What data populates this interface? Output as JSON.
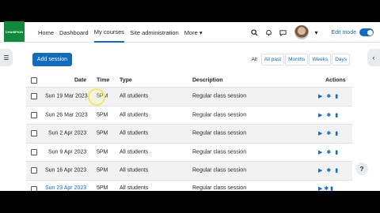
{
  "logo": {
    "text": "CHAMPION"
  },
  "nav": {
    "items": [
      {
        "label": "Home"
      },
      {
        "label": "Dashboard"
      },
      {
        "label": "My courses",
        "active": true
      },
      {
        "label": "Site administration"
      },
      {
        "label": "More ▾"
      }
    ],
    "search_icon": "search-icon",
    "bell_icon": "bell-icon",
    "chat_icon": "chat-icon",
    "edit_mode_label": "Edit mode",
    "edit_mode_on": true
  },
  "toolbar": {
    "add_session_label": "Add session",
    "filters": [
      "All",
      "All past",
      "Months",
      "Weeks",
      "Days"
    ]
  },
  "table": {
    "headers": {
      "date": "Date",
      "time": "Time",
      "type": "Type",
      "description": "Description",
      "actions": "Actions"
    },
    "rows": [
      {
        "date": "Sun 19 Mar 2023",
        "time": "5PM",
        "type": "All students",
        "description": "Regular class session"
      },
      {
        "date": "Sun 26 Mar 2023",
        "time": "5PM",
        "type": "All students",
        "description": "Regular class session"
      },
      {
        "date": "Sun 2 Apr 2023",
        "time": "5PM",
        "type": "All students",
        "description": "Regular class session"
      },
      {
        "date": "Sun 9 Apr 2023",
        "time": "5PM",
        "type": "All students",
        "description": "Regular class session"
      },
      {
        "date": "Sun 16 Apr 2023",
        "time": "5PM",
        "type": "All students",
        "description": "Regular class session"
      }
    ],
    "partial_row": {
      "date": "Sun 23 Apr 2023",
      "time": "5PM",
      "type": "All students",
      "description": "Regular class session"
    }
  },
  "colors": {
    "brand": "#0f6cbf",
    "logo_bg": "#0f8a3c"
  },
  "help_label": "?"
}
